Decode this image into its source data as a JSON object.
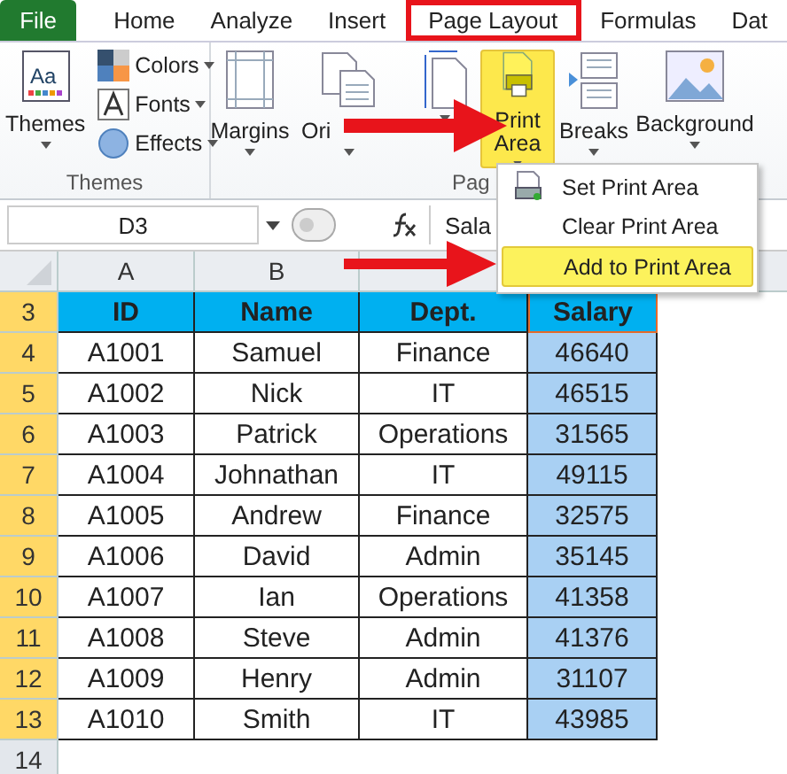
{
  "tabs": [
    {
      "label": "File",
      "kind": "file",
      "selected": false
    },
    {
      "label": "Home",
      "kind": "tab",
      "selected": false
    },
    {
      "label": "Analyze",
      "kind": "tab",
      "selected": false
    },
    {
      "label": "Insert",
      "kind": "tab",
      "selected": false
    },
    {
      "label": "Page Layout",
      "kind": "tab",
      "selected": true
    },
    {
      "label": "Formulas",
      "kind": "tab",
      "selected": false
    },
    {
      "label": "Dat",
      "kind": "tab",
      "selected": false
    }
  ],
  "ribbon": {
    "themes_group": {
      "label": "Themes",
      "themes_button": "Themes",
      "icon_text": "Aa",
      "small_buttons": [
        {
          "label": "Colors",
          "kind": "colors"
        },
        {
          "label": "Fonts",
          "kind": "fonts"
        },
        {
          "label": "Effects",
          "kind": "effects"
        }
      ]
    },
    "page_setup_group": {
      "label": "Pag",
      "buttons": [
        {
          "label": "Margins",
          "kind": "margins",
          "selected": false
        },
        {
          "label": "Ori",
          "kind": "orientation",
          "selected": false
        },
        {
          "kind": "size",
          "selected": false
        },
        {
          "label": "Print\nArea",
          "kind": "print_area",
          "selected": true
        },
        {
          "label": "Breaks",
          "kind": "breaks",
          "selected": false
        },
        {
          "label": "Background",
          "kind": "background",
          "selected": false
        }
      ]
    }
  },
  "print_area_menu": {
    "items": [
      {
        "label": "Set Print Area",
        "kind": "set",
        "selected": false
      },
      {
        "label": "Clear Print Area",
        "kind": "clear",
        "selected": false
      },
      {
        "label": "Add to Print Area",
        "kind": "add",
        "selected": true
      }
    ]
  },
  "formula_bar": {
    "name_box": "D3",
    "value": "Sala"
  },
  "sheet": {
    "columns": [
      {
        "label": "A",
        "selected": false
      },
      {
        "label": "B",
        "selected": false
      },
      {
        "selected": false
      },
      {
        "selected": true
      }
    ],
    "rows": [
      {
        "number": "3",
        "kind": "header",
        "selected": true,
        "cells": [
          "ID",
          "Name",
          "Dept.",
          "Salary"
        ]
      },
      {
        "number": "4",
        "kind": "data",
        "selected": true,
        "cells": [
          "A1001",
          "Samuel",
          "Finance",
          "46640"
        ]
      },
      {
        "number": "5",
        "kind": "data",
        "selected": true,
        "cells": [
          "A1002",
          "Nick",
          "IT",
          "46515"
        ]
      },
      {
        "number": "6",
        "kind": "data",
        "selected": true,
        "cells": [
          "A1003",
          "Patrick",
          "Operations",
          "31565"
        ]
      },
      {
        "number": "7",
        "kind": "data",
        "selected": true,
        "cells": [
          "A1004",
          "Johnathan",
          "IT",
          "49115"
        ]
      },
      {
        "number": "8",
        "kind": "data",
        "selected": true,
        "cells": [
          "A1005",
          "Andrew",
          "Finance",
          "32575"
        ]
      },
      {
        "number": "9",
        "kind": "data",
        "selected": true,
        "cells": [
          "A1006",
          "David",
          "Admin",
          "35145"
        ]
      },
      {
        "number": "10",
        "kind": "data",
        "selected": true,
        "cells": [
          "A1007",
          "Ian",
          "Operations",
          "41358"
        ]
      },
      {
        "number": "11",
        "kind": "data",
        "selected": true,
        "cells": [
          "A1008",
          "Steve",
          "Admin",
          "41376"
        ]
      },
      {
        "number": "12",
        "kind": "data",
        "selected": true,
        "cells": [
          "A1009",
          "Henry",
          "Admin",
          "31107"
        ]
      },
      {
        "number": "13",
        "kind": "data",
        "selected": true,
        "cells": [
          "A1010",
          "Smith",
          "IT",
          "43985"
        ]
      },
      {
        "number": "14",
        "kind": "empty",
        "selected": false,
        "cells": []
      }
    ]
  }
}
